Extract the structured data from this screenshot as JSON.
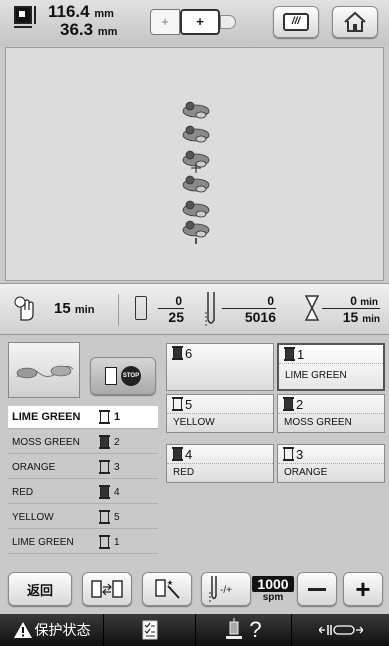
{
  "header": {
    "width_value": "116.4",
    "height_value": "36.3",
    "unit": "mm"
  },
  "status": {
    "time_value": "15",
    "time_unit": "min",
    "color_current": "0",
    "color_total": "25",
    "stitch_current": "0",
    "stitch_total": "5016",
    "elapsed": "0",
    "remaining": "15",
    "elapsed_unit": "min",
    "remaining_unit": "min"
  },
  "color_list": [
    {
      "name": "LIME GREEN",
      "spool": "1",
      "filled": false
    },
    {
      "name": "MOSS GREEN",
      "spool": "2",
      "filled": true
    },
    {
      "name": "ORANGE",
      "spool": "3",
      "filled": false
    },
    {
      "name": "RED",
      "spool": "4",
      "filled": true
    },
    {
      "name": "YELLOW",
      "spool": "5",
      "filled": false
    },
    {
      "name": "LIME GREEN",
      "spool": "1",
      "filled": false
    }
  ],
  "needles": [
    {
      "num": "6",
      "label": "",
      "filled": true
    },
    {
      "num": "1",
      "label": "LIME GREEN",
      "filled": true
    },
    {
      "num": "5",
      "label": "YELLOW",
      "filled": false
    },
    {
      "num": "2",
      "label": "MOSS GREEN",
      "filled": true
    },
    {
      "num": "4",
      "label": "RED",
      "filled": true
    },
    {
      "num": "3",
      "label": "ORANGE",
      "filled": false
    }
  ],
  "tools": {
    "back_label": "返回",
    "speed_value": "1000",
    "speed_unit": "spm"
  },
  "taskbar": {
    "protect_label": "保护状态"
  }
}
